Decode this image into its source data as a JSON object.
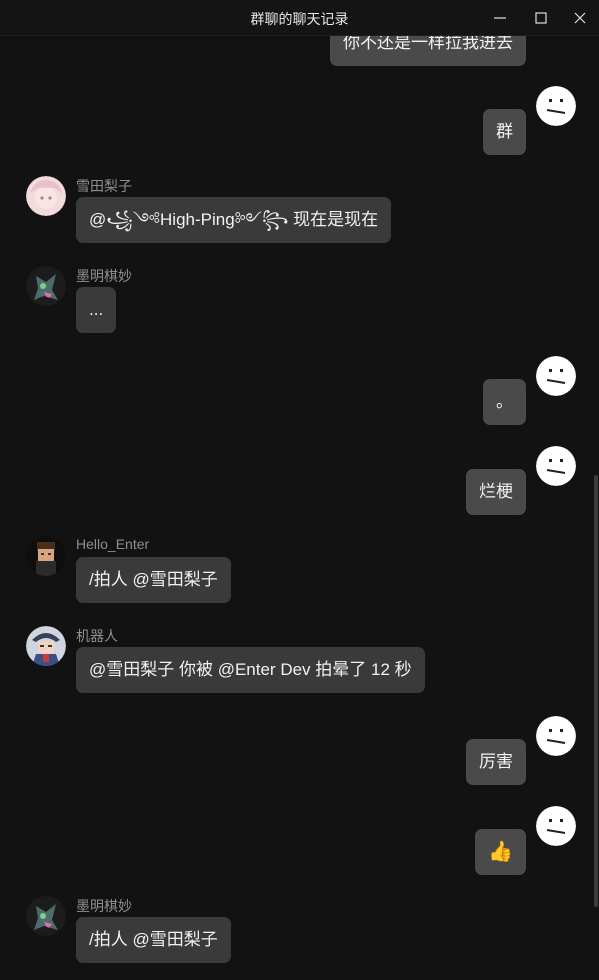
{
  "window": {
    "title": "群聊的聊天记录"
  },
  "messages": {
    "m0": {
      "side": "self",
      "text": "你不还是一样拉我进去"
    },
    "m1": {
      "side": "self",
      "text": "群"
    },
    "m2": {
      "side": "other",
      "sender": "雪田梨子",
      "text": "@꧁༺High-Ping༻꧂ 现在是现在"
    },
    "m3": {
      "side": "other",
      "sender": "墨明棋妙",
      "text": "..."
    },
    "m4": {
      "side": "self",
      "text": "。"
    },
    "m5": {
      "side": "self",
      "text": "烂梗"
    },
    "m6": {
      "side": "other",
      "sender": "Hello_Enter",
      "text": "/拍人 @雪田梨子"
    },
    "m7": {
      "side": "other",
      "sender": "机器人",
      "text": "@雪田梨子 你被 @Enter Dev 拍晕了 12 秒"
    },
    "m8": {
      "side": "self",
      "text": "厉害"
    },
    "m9": {
      "side": "self",
      "text": "👍",
      "icon": "thumbs-up-icon"
    },
    "m10": {
      "side": "other",
      "sender": "墨明棋妙",
      "text": "/拍人 @雪田梨子"
    }
  },
  "colors": {
    "background": "#121212",
    "bubble_other": "#3a3a3a",
    "bubble_self": "#4a4a4a",
    "sender_name": "#8f8f8f"
  }
}
